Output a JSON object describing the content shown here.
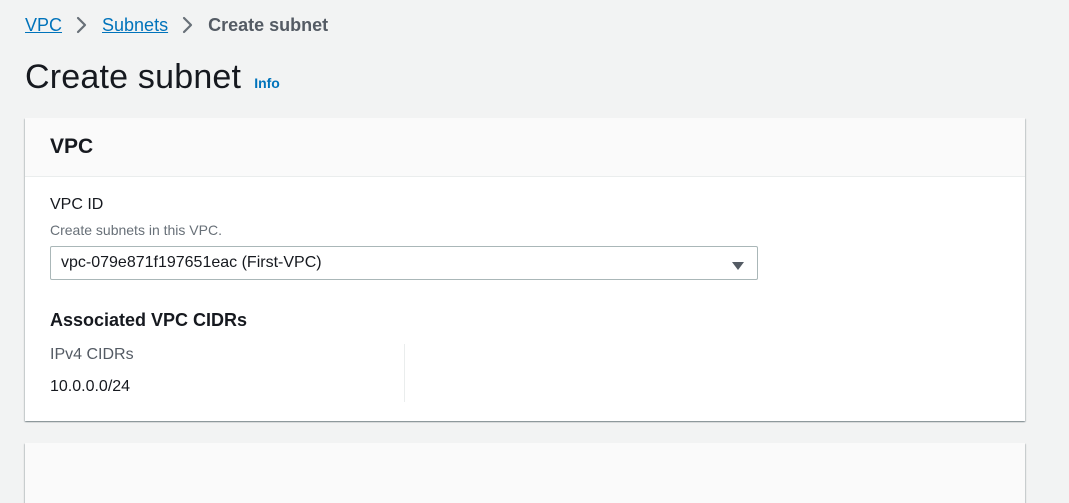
{
  "breadcrumb": {
    "items": [
      {
        "label": "VPC"
      },
      {
        "label": "Subnets"
      }
    ],
    "current": "Create subnet"
  },
  "page": {
    "title": "Create subnet",
    "info_link": "Info"
  },
  "vpc_panel": {
    "header": "VPC",
    "vpc_id": {
      "label": "VPC ID",
      "description": "Create subnets in this VPC.",
      "selected": "vpc-079e871f197651eac (First-VPC)"
    },
    "associated_cidrs": {
      "heading": "Associated VPC CIDRs",
      "ipv4_label": "IPv4 CIDRs",
      "ipv4_value": "10.0.0.0/24"
    }
  },
  "colors": {
    "link": "#0073bb",
    "background": "#f2f3f3",
    "panel_header_bg": "#fafafa",
    "text_primary": "#16191f",
    "text_secondary": "#687078"
  },
  "icons": {
    "breadcrumb_separator": "chevron-right-icon",
    "select_caret": "caret-down-icon"
  }
}
